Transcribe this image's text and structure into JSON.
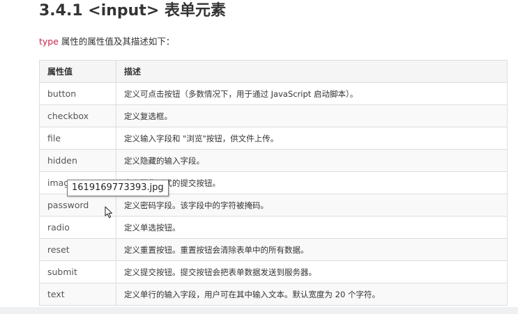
{
  "heading": "3.4.1 <input> 表单元素",
  "intro": {
    "keyword": "type",
    "text": " 属性的属性值及其描述如下："
  },
  "table": {
    "headers": [
      "属性值",
      "描述"
    ],
    "rows": [
      {
        "value": "button",
        "desc": "定义可点击按钮（多数情况下，用于通过 JavaScript 启动脚本）。"
      },
      {
        "value": "checkbox",
        "desc": "定义复选框。"
      },
      {
        "value": "file",
        "desc": "定义输入字段和 \"浏览\"按钮，供文件上传。"
      },
      {
        "value": "hidden",
        "desc": "定义隐藏的输入字段。"
      },
      {
        "value": "image",
        "desc": "定义图像形式的提交按钮。"
      },
      {
        "value": "password",
        "desc": "定义密码字段。该字段中的字符被掩码。"
      },
      {
        "value": "radio",
        "desc": "定义单选按钮。"
      },
      {
        "value": "reset",
        "desc": "定义重置按钮。重置按钮会清除表单中的所有数据。"
      },
      {
        "value": "submit",
        "desc": "定义提交按钮。提交按钮会把表单数据发送到服务器。"
      },
      {
        "value": "text",
        "desc": "定义单行的输入字段，用户可在其中输入文本。默认宽度为 20 个字符。"
      }
    ]
  },
  "tooltip": "1619169773393.jpg",
  "cursor_icon": "mouse-pointer-icon"
}
